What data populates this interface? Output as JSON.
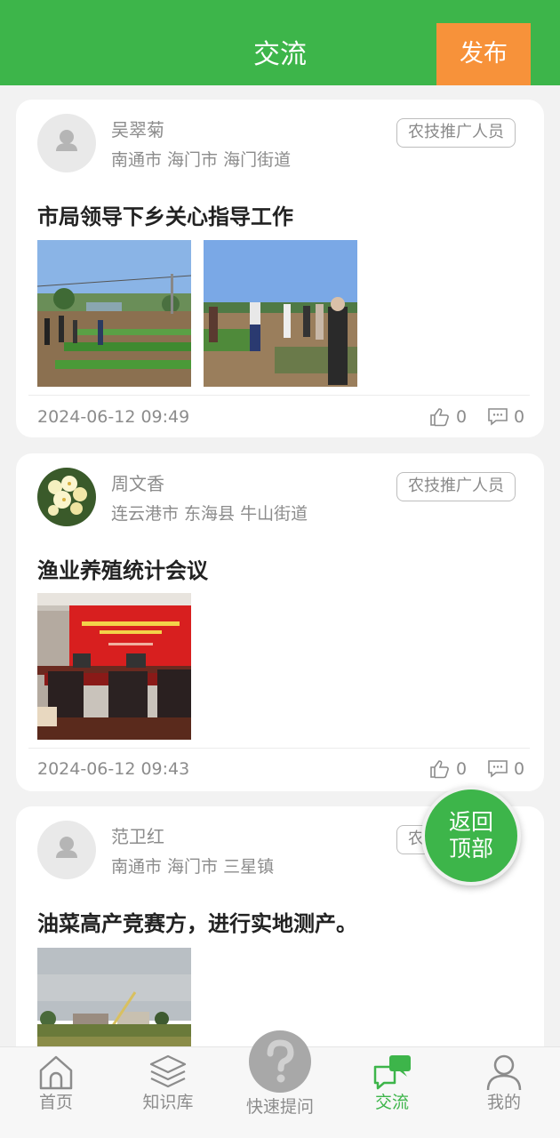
{
  "header": {
    "title": "交流",
    "publish_label": "发布"
  },
  "posts": [
    {
      "user": "吴翠菊",
      "location": "南通市 海门市 海门街道",
      "role": "农技推广人员",
      "title": "市局领导下乡关心指导工作",
      "date": "2024-06-12 09:49",
      "likes": "0",
      "comments": "0"
    },
    {
      "user": "周文香",
      "location": "连云港市 东海县 牛山街道",
      "role": "农技推广人员",
      "title": "渔业养殖统计会议",
      "date": "2024-06-12 09:43",
      "likes": "0",
      "comments": "0"
    },
    {
      "user": "范卫红",
      "location": "南通市 海门市 三星镇",
      "role": "农技推广人员",
      "title": "油菜高产竞赛方，进行实地测产。",
      "date": "",
      "likes": "",
      "comments": ""
    }
  ],
  "back_to_top": {
    "line1": "返回",
    "line2": "顶部"
  },
  "tabbar": {
    "home": "首页",
    "knowledge": "知识库",
    "quick_ask": "快速提问",
    "exchange": "交流",
    "mine": "我的"
  },
  "colors": {
    "brand_green": "#3db54a",
    "publish_orange": "#f7923a"
  }
}
